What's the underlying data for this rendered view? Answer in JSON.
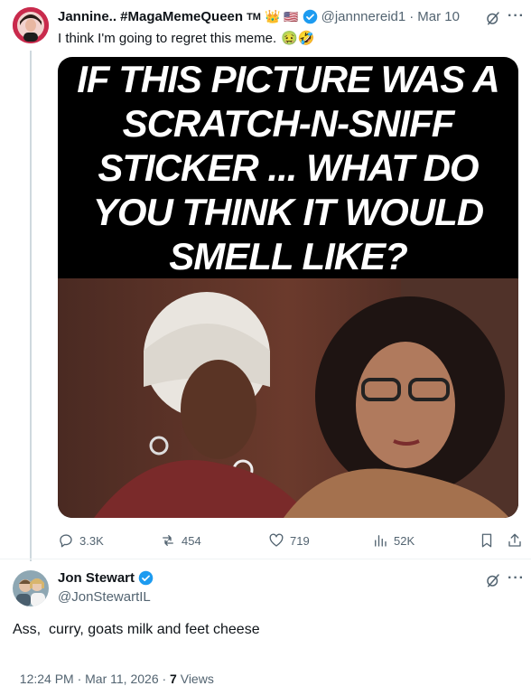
{
  "tweet": {
    "display_name": "Jannine.. #MagaMemeQueen",
    "tm": "TM",
    "handle": "@jannnereid1",
    "date": "Mar 10",
    "text": "I think I'm going to regret this meme.",
    "emoji": "🤢🤣",
    "meme_caption": "IF THIS PICTURE WAS A SCRATCH-N-SNIFF STICKER ... WHAT DO YOU THINK IT WOULD SMELL LIKE?",
    "actions": {
      "replies": "3.3K",
      "reposts": "454",
      "likes": "719",
      "views": "52K"
    }
  },
  "reply": {
    "display_name": "Jon Stewart",
    "handle": "@JonStewartIL",
    "text": "Ass,  curry, goats milk and feet cheese",
    "timestamp": "12:24 PM · Mar 11, 2026 · ",
    "views_count": "7",
    "views_label": "Views"
  },
  "colors": {
    "verified": "#1d9bf0",
    "muted": "#536471",
    "text": "#0f1419"
  }
}
